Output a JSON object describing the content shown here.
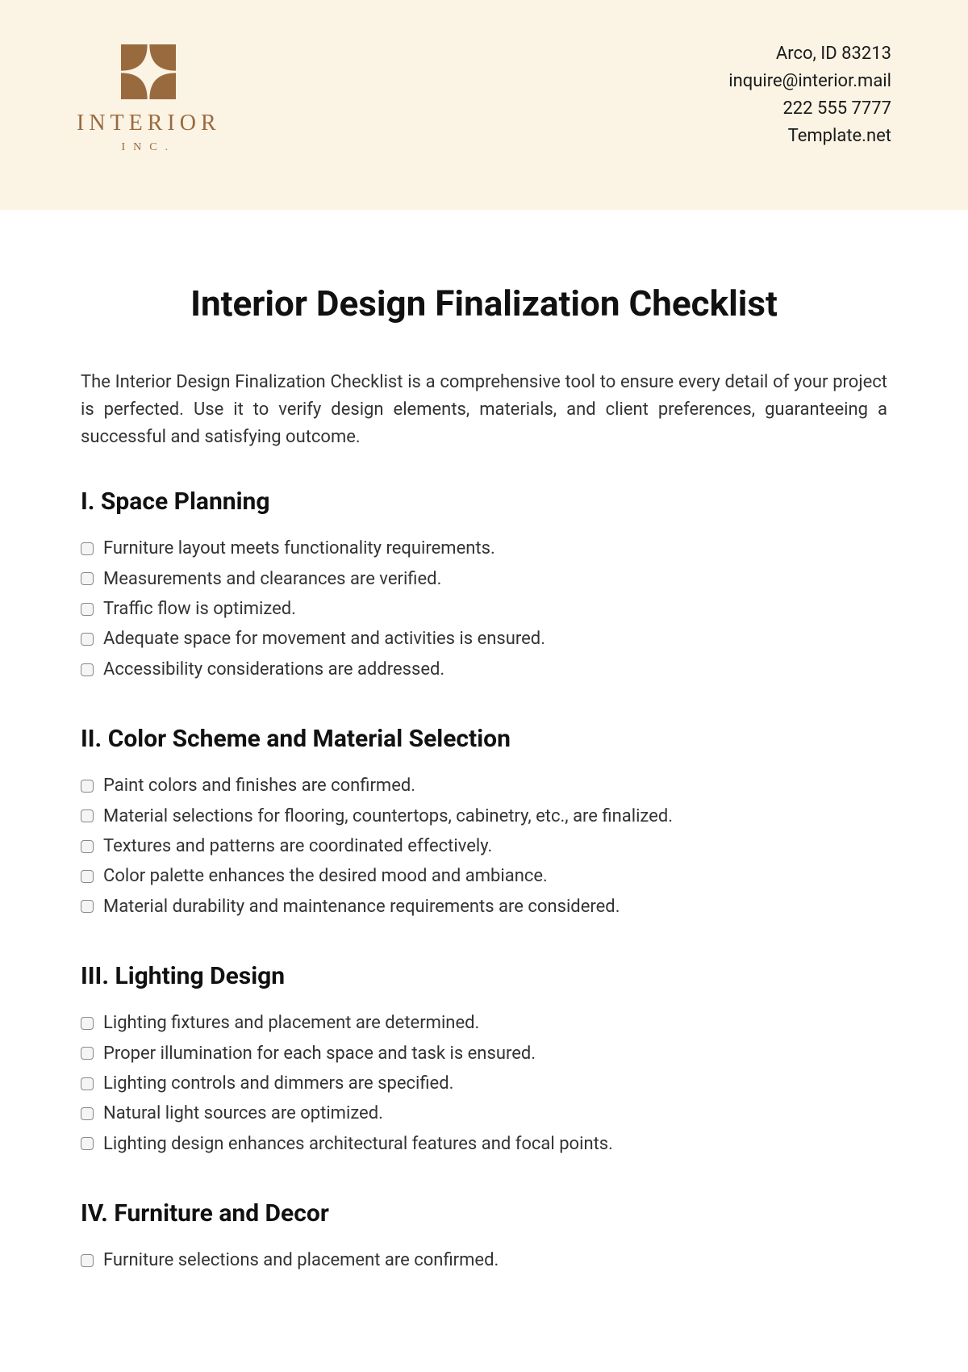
{
  "header": {
    "brand_name": "INTERIOR",
    "brand_sub": "INC.",
    "contact": {
      "address": "Arco, ID 83213",
      "email": "inquire@interior.mail",
      "phone": "222 555 7777",
      "site": "Template.net"
    }
  },
  "title": "Interior Design Finalization Checklist",
  "intro": "The Interior Design Finalization Checklist is a comprehensive tool to ensure every detail of your project is perfected. Use it to verify design elements, materials, and client preferences, guaranteeing a successful and satisfying outcome.",
  "sections": [
    {
      "heading": "I. Space Planning",
      "items": [
        "Furniture layout meets functionality requirements.",
        "Measurements and clearances are verified.",
        "Traffic flow is optimized.",
        "Adequate space for movement and activities is ensured.",
        "Accessibility considerations are addressed."
      ]
    },
    {
      "heading": "II. Color Scheme and Material Selection",
      "items": [
        "Paint colors and finishes are confirmed.",
        "Material selections for flooring, countertops, cabinetry, etc., are finalized.",
        "Textures and patterns are coordinated effectively.",
        "Color palette enhances the desired mood and ambiance.",
        "Material durability and maintenance requirements are considered."
      ]
    },
    {
      "heading": "III. Lighting Design",
      "items": [
        "Lighting fixtures and placement are determined.",
        "Proper illumination for each space and task is ensured.",
        "Lighting controls and dimmers are specified.",
        "Natural light sources are optimized.",
        "Lighting design enhances architectural features and focal points."
      ]
    },
    {
      "heading": "IV. Furniture and Decor",
      "items": [
        "Furniture selections and placement are confirmed."
      ]
    }
  ]
}
